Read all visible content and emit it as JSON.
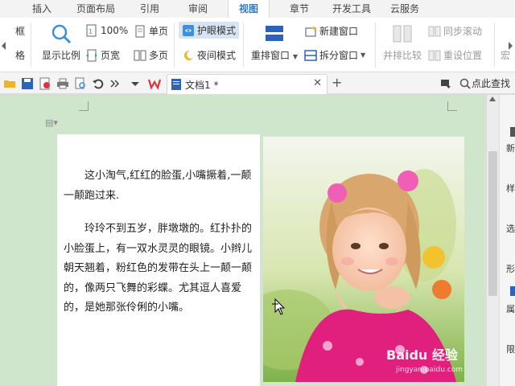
{
  "menu": {
    "tabs": [
      {
        "label": "插入",
        "active": false
      },
      {
        "label": "页面布局",
        "active": false
      },
      {
        "label": "引用",
        "active": false
      },
      {
        "label": "审阅",
        "active": false
      },
      {
        "label": "视图",
        "active": true
      },
      {
        "label": "章节",
        "active": false
      },
      {
        "label": "开发工具",
        "active": false
      },
      {
        "label": "云服务",
        "active": false
      }
    ]
  },
  "ribbon": {
    "left_partial_top": "框",
    "left_partial_bottom": "格",
    "zoom_display": "显示比例",
    "zoom_100": "100%",
    "single_page": "单页",
    "page_width": "页宽",
    "multi_page": "多页",
    "eye_protect": "护眼模式",
    "night_mode": "夜间模式",
    "rearrange_windows": "重排窗口",
    "new_window": "新建窗口",
    "split_window": "拆分窗口",
    "side_by_side": "并排比较",
    "sync_scroll": "同步滚动",
    "reset_position": "重设位置",
    "right_partial": "宏"
  },
  "quickbar": {
    "document_tab": "文档1 *",
    "search_label": "点此查找"
  },
  "document": {
    "paragraph1": "这小淘气,红红的脸蛋,小嘴撅着,一颠一颠跑过来.",
    "paragraph2": "玲玲不到五岁，胖墩墩的。红扑扑的小脸蛋上，有一双水灵灵的眼镜。小辫儿朝天翘着，粉红色的发带在头上一颠一颠的，像两只飞舞的彩蝶。尤其逗人喜爱的，是她那张伶俐的小嘴。",
    "watermark_main": "Baidu 经验",
    "watermark_sub": "jingyan.baidu.com"
  },
  "sidepanel": {
    "items": [
      "新",
      "样",
      "选",
      "形",
      "属",
      "限"
    ]
  },
  "colors": {
    "accent": "#2b7bd1",
    "doc_background": "#cfe6cd",
    "active_tab": "#2b7bd1"
  }
}
